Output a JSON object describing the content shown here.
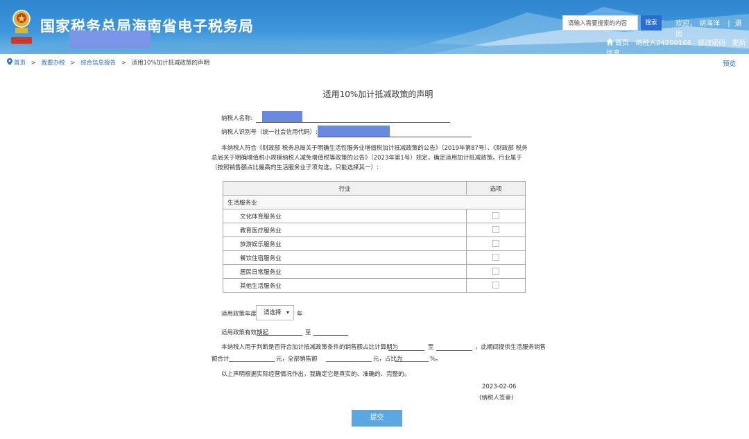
{
  "header": {
    "title": "国家税务总局海南省电子税务局",
    "search_placeholder": "请输入需要搜索的内容",
    "search_button": "搜索",
    "welcome": "欢迎，",
    "user": "胡海洋",
    "divider": "|",
    "logout": "退出",
    "home": "首页",
    "taxpayer_id": "纳税人24200166",
    "change_password": "修改密码",
    "update_info": "更新信息"
  },
  "breadcrumb": {
    "home": "首页",
    "sep": ">",
    "l1": "我要办税",
    "l2": "综合信息报告",
    "current": "适用10%加计抵减政策的声明"
  },
  "preview": "预览",
  "form": {
    "title": "适用10%加计抵减政策的声明",
    "taxpayer_name_label": "纳税人名称:",
    "taxpayer_id_label": "纳税人识别号（统一社会信用代码）:",
    "statement": "本纳税人符合《财政部 税务总局关于明确生活性服务业增值税加计抵减政策的公告》（2019年第87号）、《财政部 税务总局关于明确增值税小规模纳税人减免增值税等政策的公告》（2023年第1号）规定，确定适用加计抵减政策。行业属于（按照销售额占比最高的生活服务业子项勾选，只能选择其一）:",
    "table": {
      "col_industry": "行业",
      "col_option": "选项",
      "category": "生活服务业",
      "rows": [
        "文化体育服务业",
        "教育医疗服务业",
        "旅游娱乐服务业",
        "餐饮住宿服务业",
        "居民日常服务业",
        "其他生活服务业"
      ]
    },
    "policy_year_label": "适用政策年度",
    "policy_year_select": "请选择",
    "year_unit": "年",
    "effective_from_label": "适用政策有效期起",
    "to": "至",
    "calc_text_1": "本纳税人用于判断是否符合加计抵减政策条件的销售额占比计算期为",
    "calc_to": "至",
    "calc_text_2": "，此期间提供生活服务销售",
    "amount_total_label": "额合计",
    "yuan1": "元，全部销售额",
    "yuan2": "元，占比为",
    "percent": "%。",
    "declaration": "以上声明根据实际经营情况作出，我确定它是真实的、准确的、完整的。",
    "date": "2023-02-06",
    "signature_label": "(纳税人签章)",
    "submit": "提交"
  },
  "colors": {
    "header": "#3c95da",
    "link": "#2b6cc7",
    "submit": "#5aa7e4",
    "redaction": "#6a8ae0"
  }
}
